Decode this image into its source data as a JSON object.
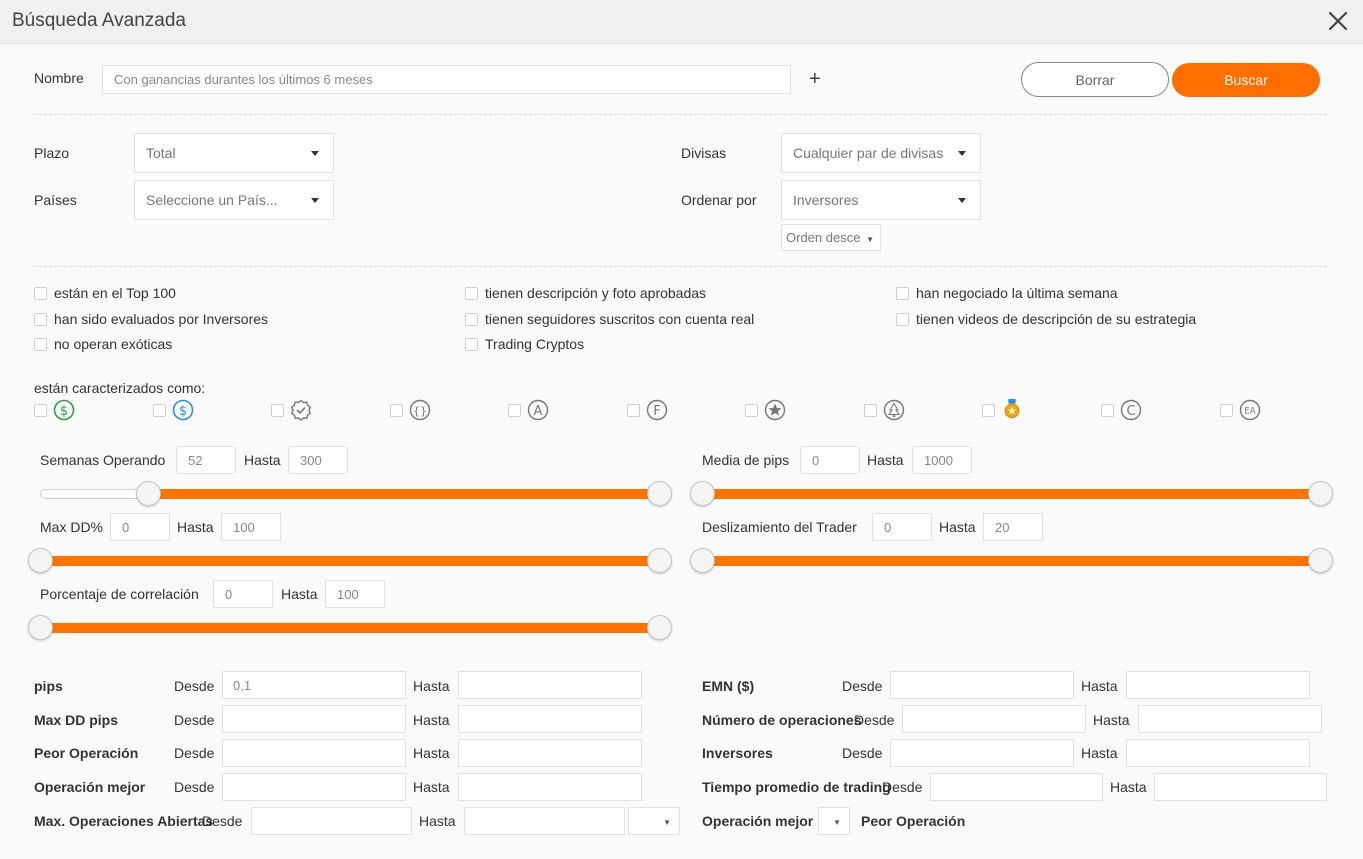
{
  "dialog": {
    "title": "Búsqueda Avanzada"
  },
  "name_row": {
    "label": "Nombre",
    "placeholder": "Con ganancias durantes los últimos 6 meses",
    "add_symbol": "+",
    "clear_label": "Borrar",
    "search_label": "Buscar"
  },
  "filters": {
    "plazo_label": "Plazo",
    "plazo_value": "Total",
    "paises_label": "Países",
    "paises_value": "Seleccione un País...",
    "divisas_label": "Divisas",
    "divisas_value": "Cualquier par de divisas",
    "ordenar_label": "Ordenar por",
    "ordenar_value": "Inversores",
    "orden_value": "Orden desce"
  },
  "checkboxes": [
    "están en el Top 100",
    "han sido evaluados por Inversores",
    "no operan exóticas",
    "tienen descripción y foto aprobadas",
    "tienen seguidores suscritos con cuenta real",
    "Trading Cryptos",
    "han negociado la última semana",
    "tienen videos de descripción de su estrategia"
  ],
  "characterized": {
    "label": "están caracterizados como:",
    "icons": [
      "dollar-green",
      "dollar-blue",
      "verified-badge",
      "braces",
      "letter-a",
      "letter-f",
      "star",
      "tree",
      "medal",
      "letter-c",
      "letter-ea"
    ],
    "ea_text": "EA",
    "a_text": "A",
    "f_text": "F",
    "c_text": "C",
    "dollar_text": "$",
    "braces_text": "{}"
  },
  "ranges": {
    "hasta": "Hasta",
    "semanas": {
      "label": "Semanas Operando",
      "from": "52",
      "to": "300",
      "fill_start": 0.14,
      "fill_end": 1.0
    },
    "maxdd": {
      "label": "Max DD%",
      "from": "0",
      "to": "100",
      "fill_start": 0,
      "fill_end": 1.0
    },
    "correlacion": {
      "label": "Porcentaje de correlación",
      "from": "0",
      "to": "100",
      "fill_start": 0,
      "fill_end": 1.0
    },
    "pips_media": {
      "label": "Media de pips",
      "from": "0",
      "to": "1000",
      "fill_start": 0,
      "fill_end": 1.0
    },
    "deslizamiento": {
      "label": "Deslizamiento del Trader",
      "from": "0",
      "to": "20",
      "fill_start": 0,
      "fill_end": 1.0
    }
  },
  "fields": {
    "desde": "Desde",
    "hasta": "Hasta",
    "pips": "pips",
    "pips_from": "0,1",
    "maxdd_pips": "Max DD pips",
    "peor_op": "Peor Operación",
    "op_mejor": "Operación mejor",
    "max_abiertas": "Max. Operaciones Abiertas",
    "emn": "EMN ($)",
    "num_ops": "Número de operaciones",
    "inversores": "Inversores",
    "tiempo": "Tiempo promedio de trading",
    "op_mejor2": "Operación mejor",
    "peor_op2": "Peor Operación"
  },
  "colors": {
    "accent": "#ff6f00",
    "green": "#2e9d4a",
    "blue": "#2b8fd6",
    "gold": "#e8a817"
  }
}
